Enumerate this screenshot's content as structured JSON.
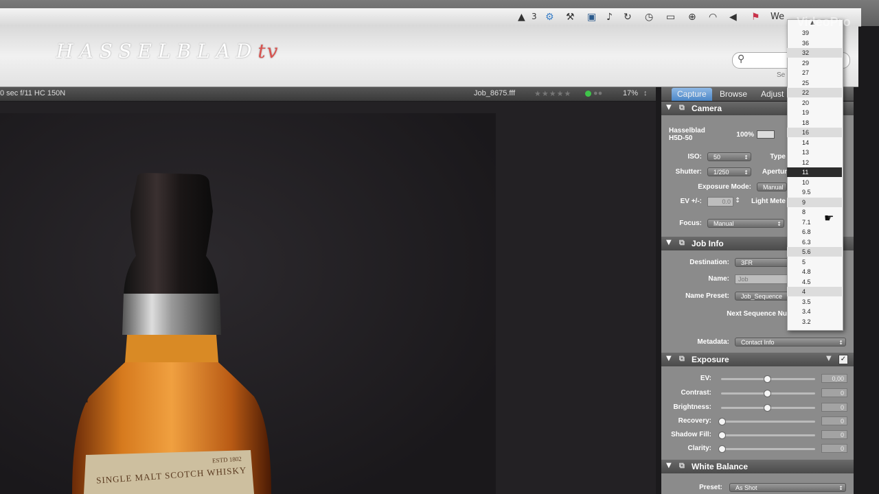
{
  "menubar": {
    "adobe_badge": "3",
    "clock_text": "We"
  },
  "header": {
    "logo_main": "HASSELBLAD",
    "logo_tv": "tv",
    "search_caption": "Se"
  },
  "infobar": {
    "exposure_text": "0 sec  f/11  HC 150N",
    "filename": "Job_8675.fff",
    "zoom": "17%"
  },
  "tabs": [
    {
      "label": "Capture",
      "active": true
    },
    {
      "label": "Browse",
      "active": false
    },
    {
      "label": "Adjust",
      "active": false
    }
  ],
  "camera": {
    "title": "Camera",
    "model": "Hasselblad H5D-50",
    "battery": "100%",
    "iso_label": "ISO:",
    "iso_value": "50",
    "type_label": "Type",
    "shutter_label": "Shutter:",
    "shutter_value": "1/250",
    "aperture_label": "Apertur",
    "exposure_mode_label": "Exposure Mode:",
    "exposure_mode_value": "Manual",
    "ev_label": "EV +/-:",
    "ev_value": "0.0",
    "light_meter_label": "Light Mete",
    "focus_label": "Focus:",
    "focus_value": "Manual"
  },
  "job_info": {
    "title": "Job Info",
    "destination_label": "Destination:",
    "destination_value": "3FR",
    "name_label": "Name:",
    "name_value": "Job",
    "name_preset_label": "Name Preset:",
    "name_preset_value": "Job_Sequence",
    "next_seq_label": "Next Sequence Nu",
    "metadata_label": "Metadata:",
    "metadata_value": "Contact Info"
  },
  "exposure": {
    "title": "Exposure",
    "sliders": [
      {
        "label": "EV:",
        "value": "0,00",
        "level": 0.48
      },
      {
        "label": "Contrast:",
        "value": "0",
        "level": 0.48
      },
      {
        "label": "Brightness:",
        "value": "0",
        "level": 0.48
      },
      {
        "label": "Recovery:",
        "value": "0",
        "level": 0.0
      },
      {
        "label": "Shadow Fill:",
        "value": "0",
        "level": 0.0
      },
      {
        "label": "Clarity:",
        "value": "0",
        "level": 0.0
      }
    ]
  },
  "white_balance": {
    "title": "White Balance",
    "preset_label": "Preset:",
    "preset_value": "As Shot"
  },
  "aperture_dropdown": {
    "items": [
      "39",
      "36",
      "32",
      "29",
      "27",
      "25",
      "22",
      "20",
      "19",
      "18",
      "16",
      "14",
      "13",
      "12",
      "11",
      "10",
      "9.5",
      "9",
      "8",
      "7.1",
      "6.8",
      "6.3",
      "5.6",
      "5",
      "4.8",
      "4.5",
      "4",
      "3.5",
      "3.4",
      "3.2"
    ],
    "selected": "11",
    "highlighted": [
      "32",
      "22",
      "16",
      "9",
      "5.6",
      "4"
    ]
  },
  "photo": {
    "label_line1": "ESTD 1802",
    "label_line2": "SINGLE MALT SCOTCH WHISKY"
  },
  "watermark": "VideoPro"
}
